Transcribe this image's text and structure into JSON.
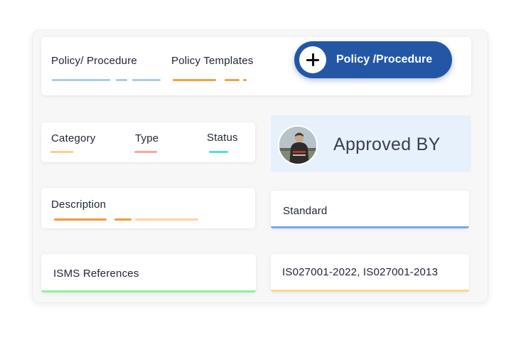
{
  "tabs": [
    {
      "label": "Policy/ Procedure",
      "colors": [
        "#a8cde0",
        "#a8cde0",
        "#a8cde0"
      ]
    },
    {
      "label": "Policy Templates",
      "colors": [
        "#f0a04a",
        "#f0a04a",
        "#f0a04a"
      ]
    }
  ],
  "add_button": {
    "label": "Policy /Procedure",
    "icon": "plus-icon",
    "color": "#2456a6"
  },
  "filters": [
    {
      "label": "Category",
      "color": "#fbcf8a"
    },
    {
      "label": "Type",
      "color": "#f6a7a0"
    },
    {
      "label": "Status",
      "color": "#4fe3d6"
    }
  ],
  "approved": {
    "label": "Approved BY",
    "avatar": "user-avatar",
    "bg": "#e6f1fc"
  },
  "description": {
    "label": "Description",
    "colors": [
      "#f39a3b",
      "#f39a3b",
      "#fcd2a5"
    ]
  },
  "standard": {
    "label": "Standard",
    "color": "#7aa7f0"
  },
  "isms": {
    "label": "ISMS References",
    "color": "#92ef9e"
  },
  "iso": {
    "label": "IS027001-2022, IS027001-2013",
    "color": "#fbd88a"
  }
}
